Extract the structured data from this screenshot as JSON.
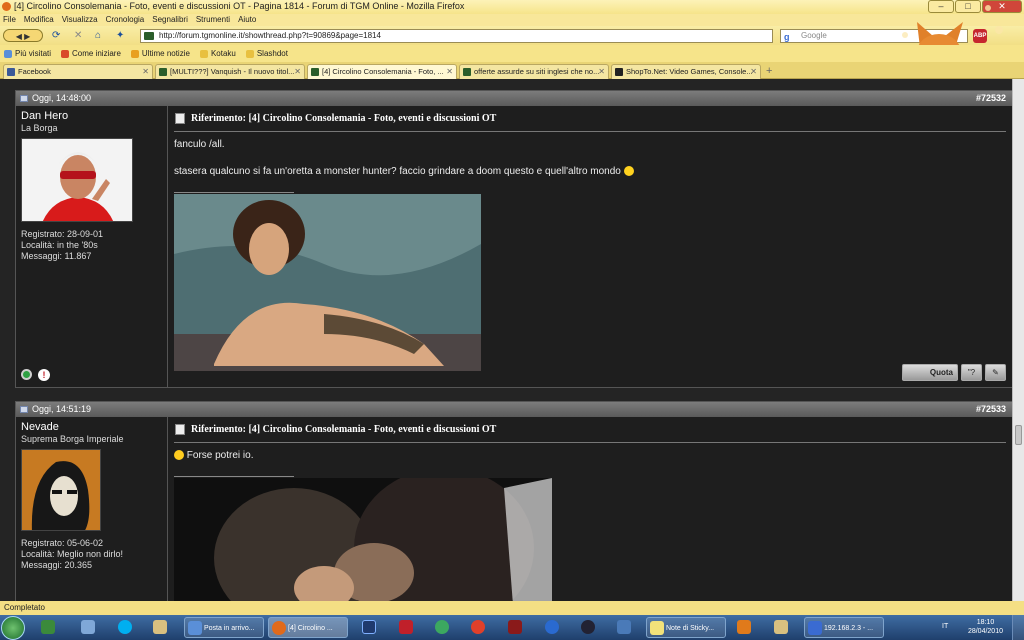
{
  "window": {
    "title": "[4] Circolino Consolemania - Foto, eventi e discussioni OT - Pagina 1814 - Forum di TGM Online - Mozilla Firefox",
    "min": "–",
    "max": "□",
    "close": "✕"
  },
  "menu": [
    "File",
    "Modifica",
    "Visualizza",
    "Cronologia",
    "Segnalibri",
    "Strumenti",
    "Aiuto"
  ],
  "nav": {
    "url": "http://forum.tgmonline.it/showthread.php?t=90869&page=1814",
    "search_placeholder": "Google",
    "abp": "ABP"
  },
  "bookmarks": [
    {
      "label": "Più visitati",
      "color": "#5a8fd8"
    },
    {
      "label": "Come iniziare",
      "color": "#d94a2a"
    },
    {
      "label": "Ultime notizie",
      "color": "#e8a020"
    },
    {
      "label": "Kotaku",
      "color": "#e8c040"
    },
    {
      "label": "Slashdot",
      "color": "#e8c040"
    }
  ],
  "tabs": [
    {
      "label": "Facebook",
      "active": false
    },
    {
      "label": "[MULTI???] Vanquish - Il nuovo titol...",
      "active": false
    },
    {
      "label": "[4] Circolino Consolemania - Foto, ...",
      "active": true
    },
    {
      "label": "offerte assurde su siti inglesi che no...",
      "active": false
    },
    {
      "label": "ShopTo.Net: Video Games, Console...",
      "active": false
    }
  ],
  "posts": [
    {
      "date": "Oggi, 14:48:00",
      "number": "#72532",
      "username": "Dan Hero",
      "usertitle": "La Borga",
      "registered": "Registrato: 28-09-01",
      "location": "Località: in the '80s",
      "messages": "Messaggi: 11.867",
      "ref_title": "Riferimento: [4] Circolino Consolemania - Foto, eventi e discussioni OT",
      "line1": "fanculo /all.",
      "line2": "stasera qualcuno si fa un'oretta a monster hunter? faccio grindare a doom questo e quell'altro mondo"
    },
    {
      "date": "Oggi, 14:51:19",
      "number": "#72533",
      "username": "Nevade",
      "usertitle": "Suprema Borga Imperiale",
      "registered": "Registrato: 05-06-02",
      "location": "Località: Meglio non dirlo!",
      "messages": "Messaggi: 20.365",
      "ref_title": "Riferimento: [4] Circolino Consolemania - Foto, eventi e discussioni OT",
      "line1": "Forse potrei io."
    }
  ],
  "buttons": {
    "quote": "Quota",
    "multiquote": "\"?",
    "edit": "✎"
  },
  "status": "Completato",
  "taskbar": {
    "items": [
      {
        "label": "Posta in arrivo...",
        "color": "#5a8fd8",
        "type": "button"
      },
      {
        "label": "[4] Circolino ...",
        "color": "#e06a1b",
        "type": "button-active"
      },
      {
        "label": "Note di Sticky...",
        "color": "#f2e27a",
        "type": "button"
      },
      {
        "label": "192.168.2.3 - ...",
        "color": "#3a6bd2",
        "type": "button"
      }
    ],
    "lang": "IT",
    "time": "18:10",
    "date": "28/04/2010"
  }
}
